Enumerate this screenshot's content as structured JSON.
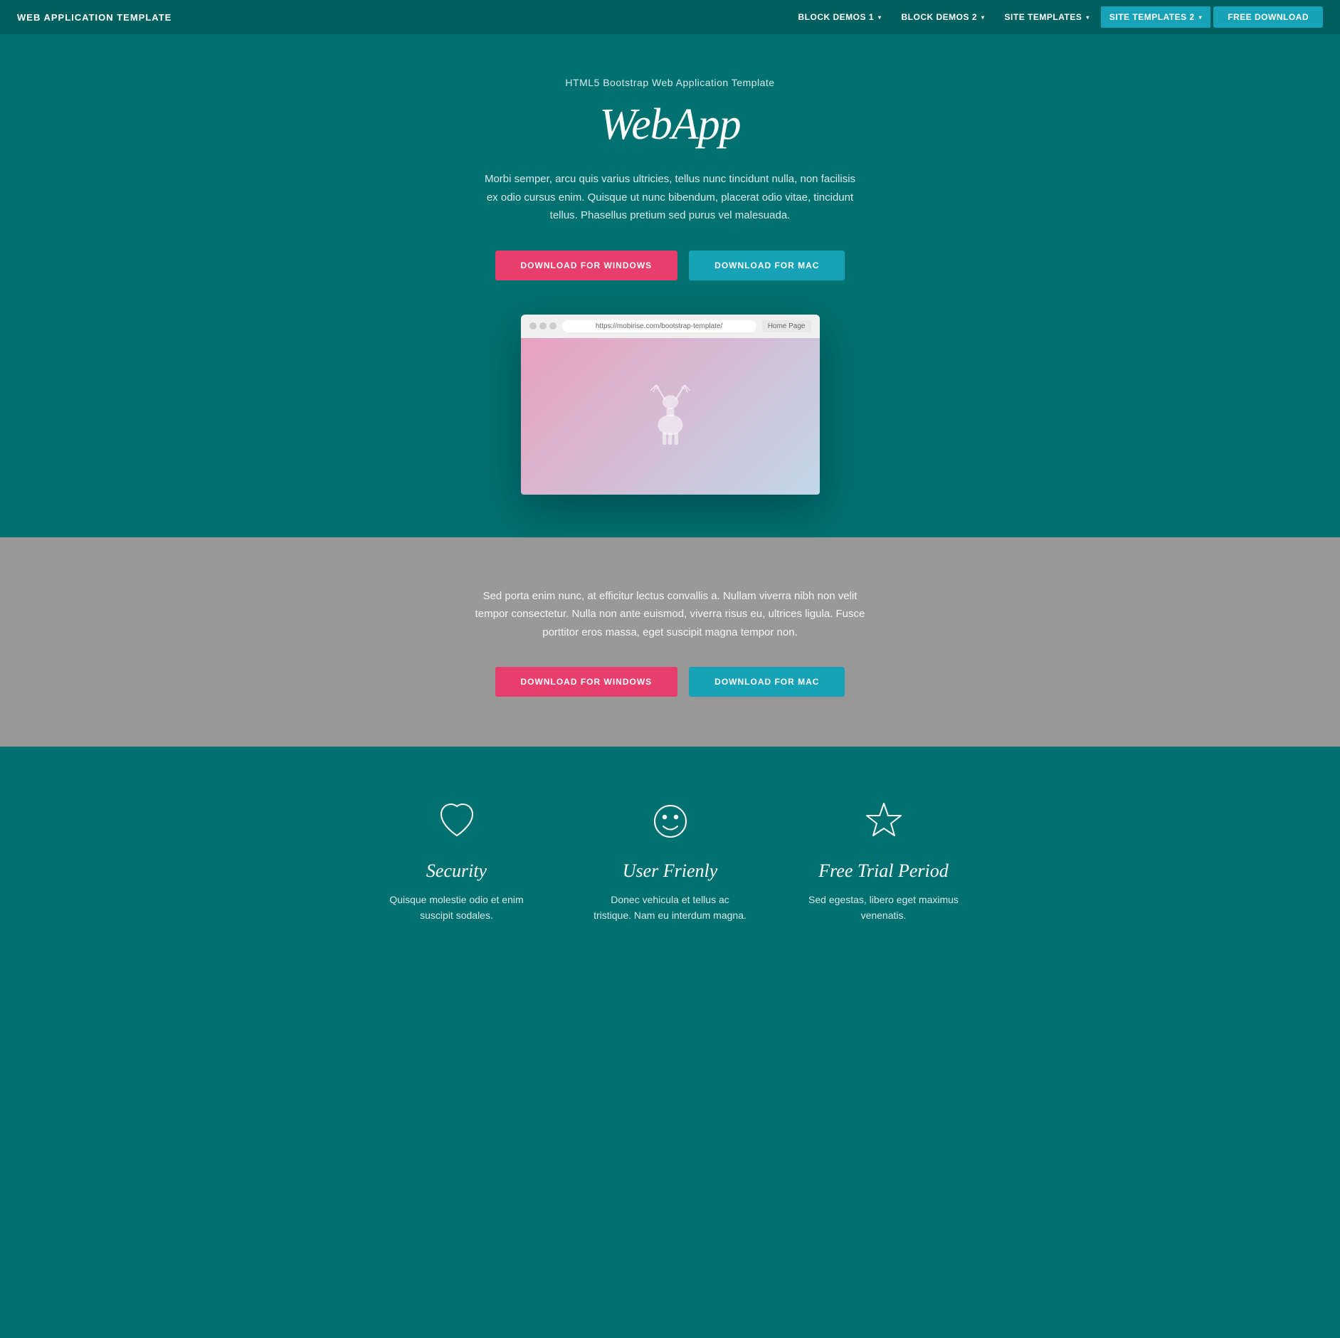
{
  "navbar": {
    "brand": "WEB APPLICATION TEMPLATE",
    "links": [
      {
        "label": "BLOCK DEMOS 1",
        "has_caret": true
      },
      {
        "label": "BLOCK DEMOS 2",
        "has_caret": true
      },
      {
        "label": "SITE TEMPLATES",
        "has_caret": true
      },
      {
        "label": "SITE TEMPLATES 2",
        "has_caret": true,
        "active": true
      }
    ],
    "cta_label": "FREE DOWNLOAD"
  },
  "hero": {
    "subtitle": "HTML5 Bootstrap Web Application Template",
    "title": "WebApp",
    "description": "Morbi semper, arcu quis varius ultricies, tellus nunc tincidunt nulla, non facilisis ex odio cursus enim. Quisque ut nunc bibendum, placerat odio vitae, tincidunt tellus. Phasellus pretium sed purus vel malesuada.",
    "btn_windows": "DOWNLOAD FOR WINDOWS",
    "btn_mac": "DOWNLOAD FOR MAC",
    "browser_url": "https://mobirise.com/bootstrap-template/",
    "browser_home": "Home Page"
  },
  "gray_section": {
    "description": "Sed porta enim nunc, at efficitur lectus convallis a. Nullam viverra nibh non velit tempor consectetur. Nulla non ante euismod, viverra risus eu, ultrices ligula. Fusce porttitor eros massa, eget suscipit magna tempor non.",
    "btn_windows": "DOWNLOAD FOR WINDOWS",
    "btn_mac": "DOWNLOAD FOR MAC"
  },
  "features": {
    "items": [
      {
        "icon": "heart",
        "title": "Security",
        "description": "Quisque molestie odio et enim suscipit sodales."
      },
      {
        "icon": "smiley",
        "title": "User Frienly",
        "description": "Donec vehicula et tellus ac tristique. Nam eu interdum magna."
      },
      {
        "icon": "star",
        "title": "Free Trial Period",
        "description": "Sed egestas, libero eget maximus venenatis."
      }
    ]
  }
}
